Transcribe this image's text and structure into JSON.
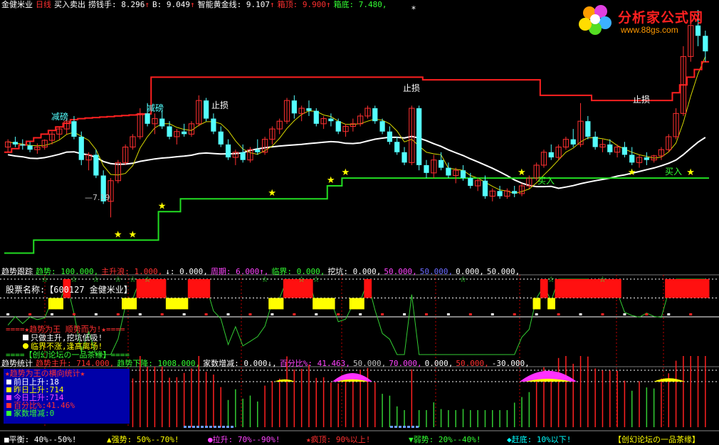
{
  "header": {
    "stock": "金健米业",
    "period": "日线",
    "indicator": "买入卖出",
    "items": [
      {
        "label": "捞钱手: 8.296",
        "arrow": "↑",
        "color": "#ffffff"
      },
      {
        "label": "B: 9.049",
        "arrow": "↑",
        "color": "#ffffff"
      },
      {
        "label": "智能黄金线: 9.107",
        "arrow": "↑",
        "color": "#ffffff"
      },
      {
        "label": "箱顶: 9.900",
        "arrow": "↑",
        "color": "#ff3030"
      },
      {
        "label": "箱底: 7.480,",
        "arrow": "",
        "color": "#33ff33"
      }
    ]
  },
  "logo": {
    "title": "分析家公式网",
    "url": "www.88gs.com"
  },
  "main_chart": {
    "annotations": {
      "stop_loss": "止损",
      "buy": "买入",
      "reduce": "减磅",
      "low_price": "7.19"
    }
  },
  "panel2": {
    "header": [
      {
        "text": "趋势跟踪",
        "color": "#ffffff"
      },
      {
        "text": "趋势: 100.000,",
        "color": "#33ff33"
      },
      {
        "text": "主升浪: 1.000,",
        "color": "#ff3030"
      },
      {
        "text": "↓: 0.000,",
        "color": "#ffffff"
      },
      {
        "text": "周期: 6.000↑,",
        "color": "#ff44ff"
      },
      {
        "text": "临界: 0.000,",
        "color": "#33ff33"
      },
      {
        "text": "挖坑: 0.000,",
        "color": "#ffffff"
      },
      {
        "text": "50.000,",
        "color": "#ff44ff"
      },
      {
        "text": "50.000,",
        "color": "#6b6bff"
      },
      {
        "text": "0.000,",
        "color": "#ffffff"
      },
      {
        "text": "50.000,",
        "color": "#ffffff"
      }
    ],
    "stock_name_label": "股票名称:",
    "stock_name_value": "【600127 金健米业】",
    "legend_title": "====★趋势为王 顺势而为!★====",
    "legend_items": [
      {
        "text": "只做主升,挖坑低吸!",
        "color": "#ffffff"
      },
      {
        "text": "临界不涨,逢高离场!",
        "color": "#ffff00"
      }
    ],
    "legend_footer": "====【创幻论坛の一品茶缘】===="
  },
  "panel3": {
    "header": [
      {
        "text": "趋势统计",
        "color": "#ffffff"
      },
      {
        "text": "趋势主升: 714.000,",
        "color": "#ff3030"
      },
      {
        "text": "趋势下降: 1008.000,",
        "color": "#33ff33"
      },
      {
        "text": "家数增减: 0.000↓,",
        "color": "#ffffff"
      },
      {
        "text": "百分比%: 41.463,",
        "color": "#ff44ff"
      },
      {
        "text": "50.000,",
        "color": "#c0c0c0"
      },
      {
        "text": "70.000,",
        "color": "#ff44ff"
      },
      {
        "text": "0.000,",
        "color": "#ffffff"
      },
      {
        "text": "50.000,",
        "color": "#ff3030"
      },
      {
        "text": "-30.000,",
        "color": "#ffffff"
      }
    ],
    "stats_title": "★趋势为王の横向统计★",
    "stats_rows": [
      {
        "label": "前日上升:",
        "value": "18",
        "color": "#ffffff"
      },
      {
        "label": "昨日上升:",
        "value": "714",
        "color": "#ffff00"
      },
      {
        "label": "今日上升:",
        "value": "714",
        "color": "#ff44ff"
      },
      {
        "label": "百分比%:",
        "value": "41.46%",
        "color": "#ff3030"
      },
      {
        "label": "家数增减:",
        "value": "0",
        "color": "#33ff33"
      }
    ]
  },
  "footer": [
    {
      "icon": "■",
      "text": "平衡: 40%--50%!",
      "color": "#ffffff"
    },
    {
      "icon": "▲",
      "text": "强势: 50%--70%!",
      "color": "#ffff00"
    },
    {
      "icon": "●",
      "text": "拉升: 70%--90%!",
      "color": "#ff44ff"
    },
    {
      "icon": "★",
      "text": "疯顶: 90%以上!",
      "color": "#ff3030"
    },
    {
      "icon": "▼",
      "text": "弱势: 20%--40%!",
      "color": "#33ff33"
    },
    {
      "icon": "◆",
      "text": "赶底: 10%以下!",
      "color": "#00ffff"
    },
    {
      "icon": "",
      "text": "【创幻论坛の一品茶缘】",
      "color": "#ffff00"
    }
  ],
  "chart_data": {
    "type": "candlestick",
    "box_top": 9.9,
    "box_bottom": 7.48,
    "price_range": [
      6.3,
      11.2
    ],
    "x_label_low": "7.19",
    "ohlc": [
      [
        8.55,
        8.7,
        8.45,
        8.65
      ],
      [
        8.65,
        8.75,
        8.55,
        8.6
      ],
      [
        8.6,
        8.7,
        8.5,
        8.58
      ],
      [
        8.58,
        8.65,
        8.45,
        8.5
      ],
      [
        8.5,
        8.62,
        8.42,
        8.55
      ],
      [
        8.55,
        8.7,
        8.5,
        8.68
      ],
      [
        8.68,
        8.85,
        8.6,
        8.8
      ],
      [
        8.8,
        8.95,
        8.7,
        8.9
      ],
      [
        8.9,
        9.1,
        8.8,
        9.05
      ],
      [
        9.05,
        9.15,
        8.7,
        8.75
      ],
      [
        8.75,
        8.85,
        8.2,
        8.3
      ],
      [
        8.3,
        8.45,
        8.1,
        8.4
      ],
      [
        8.4,
        8.5,
        7.95,
        8.0
      ],
      [
        8.0,
        8.1,
        7.45,
        7.5
      ],
      [
        7.5,
        7.95,
        7.19,
        7.9
      ],
      [
        7.9,
        8.3,
        7.85,
        8.25
      ],
      [
        8.25,
        8.6,
        8.2,
        8.55
      ],
      [
        8.55,
        8.8,
        8.5,
        8.75
      ],
      [
        8.75,
        9.3,
        8.7,
        9.2
      ],
      [
        9.2,
        9.4,
        8.95,
        9.0
      ],
      [
        9.0,
        9.2,
        8.8,
        9.1
      ],
      [
        9.1,
        9.25,
        8.9,
        8.95
      ],
      [
        8.95,
        9.05,
        8.7,
        8.75
      ],
      [
        8.75,
        8.9,
        8.6,
        8.85
      ],
      [
        8.85,
        9.0,
        8.75,
        8.8
      ],
      [
        8.8,
        9.05,
        8.75,
        9.0
      ],
      [
        9.0,
        9.55,
        8.95,
        9.45
      ],
      [
        9.45,
        9.5,
        9.05,
        9.1
      ],
      [
        9.1,
        9.2,
        8.8,
        8.85
      ],
      [
        8.85,
        8.95,
        8.55,
        8.6
      ],
      [
        8.6,
        8.7,
        8.3,
        8.35
      ],
      [
        8.35,
        8.5,
        8.2,
        8.45
      ],
      [
        8.45,
        8.6,
        8.25,
        8.3
      ],
      [
        8.3,
        8.55,
        8.25,
        8.5
      ],
      [
        8.5,
        8.7,
        8.4,
        8.45
      ],
      [
        8.45,
        8.75,
        8.4,
        8.7
      ],
      [
        8.7,
        8.95,
        8.6,
        8.9
      ],
      [
        8.9,
        9.1,
        8.8,
        9.05
      ],
      [
        9.05,
        9.5,
        9.0,
        9.45
      ],
      [
        9.45,
        9.55,
        9.1,
        9.2
      ],
      [
        9.2,
        9.35,
        9.05,
        9.3
      ],
      [
        9.3,
        9.45,
        9.15,
        9.25
      ],
      [
        9.25,
        9.3,
        8.95,
        9.0
      ],
      [
        9.0,
        9.15,
        8.9,
        9.1
      ],
      [
        9.1,
        9.2,
        8.95,
        9.05
      ],
      [
        9.05,
        9.1,
        8.8,
        8.85
      ],
      [
        8.85,
        9.0,
        8.75,
        8.95
      ],
      [
        8.95,
        9.1,
        8.85,
        9.0
      ],
      [
        9.0,
        9.2,
        8.95,
        9.15
      ],
      [
        9.15,
        9.35,
        9.1,
        9.3
      ],
      [
        9.3,
        9.35,
        9.0,
        9.05
      ],
      [
        9.05,
        9.1,
        8.8,
        8.85
      ],
      [
        8.85,
        8.95,
        8.6,
        8.65
      ],
      [
        8.65,
        8.75,
        8.4,
        8.45
      ],
      [
        8.45,
        8.55,
        8.2,
        8.25
      ],
      [
        8.25,
        9.35,
        8.2,
        9.3
      ],
      [
        9.3,
        9.35,
        8.1,
        8.2
      ],
      [
        8.2,
        8.3,
        7.95,
        8.05
      ],
      [
        8.05,
        8.4,
        7.95,
        8.3
      ],
      [
        8.3,
        8.45,
        8.1,
        8.15
      ],
      [
        8.15,
        8.25,
        7.95,
        8.0
      ],
      [
        8.0,
        8.15,
        7.85,
        8.1
      ],
      [
        8.1,
        8.2,
        7.9,
        7.95
      ],
      [
        7.95,
        8.05,
        7.75,
        7.8
      ],
      [
        7.8,
        7.95,
        7.7,
        7.9
      ],
      [
        7.9,
        8.0,
        7.55,
        7.6
      ],
      [
        7.6,
        7.75,
        7.5,
        7.7
      ],
      [
        7.7,
        7.8,
        7.55,
        7.6
      ],
      [
        7.6,
        7.75,
        7.55,
        7.7
      ],
      [
        7.7,
        7.8,
        7.58,
        7.65
      ],
      [
        7.65,
        7.85,
        7.6,
        7.8
      ],
      [
        7.8,
        8.0,
        7.75,
        7.95
      ],
      [
        7.95,
        8.25,
        7.9,
        8.2
      ],
      [
        8.2,
        8.5,
        8.15,
        8.45
      ],
      [
        8.45,
        8.6,
        8.3,
        8.35
      ],
      [
        8.35,
        8.6,
        8.3,
        8.55
      ],
      [
        8.55,
        8.75,
        8.5,
        8.7
      ],
      [
        8.7,
        8.9,
        8.55,
        8.6
      ],
      [
        8.6,
        9.4,
        8.55,
        9.05
      ],
      [
        9.05,
        9.15,
        8.7,
        8.75
      ],
      [
        8.75,
        8.85,
        8.5,
        8.55
      ],
      [
        8.55,
        8.7,
        8.45,
        8.6
      ],
      [
        8.6,
        8.7,
        8.4,
        8.45
      ],
      [
        8.45,
        8.6,
        8.35,
        8.55
      ],
      [
        8.55,
        8.65,
        8.35,
        8.4
      ],
      [
        8.4,
        8.55,
        8.2,
        8.25
      ],
      [
        8.25,
        8.4,
        8.15,
        8.35
      ],
      [
        8.35,
        8.45,
        8.2,
        8.3
      ],
      [
        8.3,
        8.4,
        8.25,
        8.38
      ],
      [
        8.38,
        8.55,
        8.3,
        8.5
      ],
      [
        8.5,
        8.8,
        8.45,
        8.75
      ],
      [
        8.75,
        9.3,
        8.7,
        9.2
      ],
      [
        9.2,
        10.5,
        9.15,
        10.3
      ],
      [
        10.3,
        11.0,
        10.2,
        10.9
      ],
      [
        10.9,
        11.2,
        10.5,
        10.7
      ],
      [
        10.7,
        10.8,
        10.2,
        10.4
      ]
    ],
    "trend_panel": {
      "levels": [
        100,
        50,
        0
      ],
      "series_name": "趋势"
    },
    "stats_panel": {
      "levels": [
        70,
        50,
        -30
      ],
      "percent": 41.463
    }
  }
}
